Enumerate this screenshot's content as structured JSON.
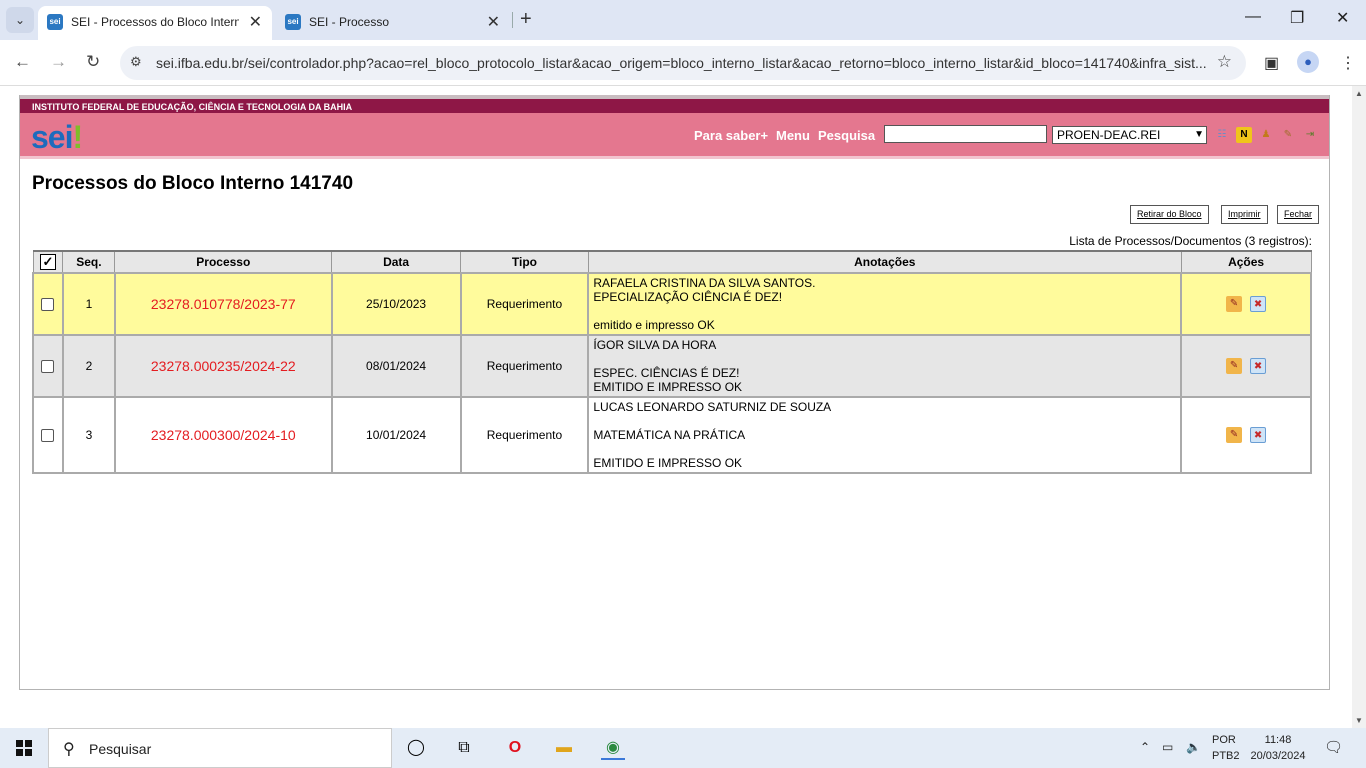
{
  "browser": {
    "tabs": [
      {
        "title": "SEI - Processos do Bloco Interno"
      },
      {
        "title": "SEI - Processo"
      }
    ],
    "new_tab": "+",
    "url": "sei.ifba.edu.br/sei/controlador.php?acao=rel_bloco_protocolo_listar&acao_origem=bloco_interno_listar&acao_retorno=bloco_interno_listar&id_bloco=141740&infra_sist..."
  },
  "sei": {
    "institution": "INSTITUTO FEDERAL DE EDUCAÇÃO, CIÊNCIA E TECNOLOGIA DA BAHIA",
    "logo": "sei",
    "nav": {
      "help": "Para saber+",
      "menu": "Menu",
      "search": "Pesquisa"
    },
    "search_value": "",
    "unit_select": "PROEN-DEAC.REI",
    "page_title": "Processos do Bloco Interno 141740",
    "buttons": {
      "remove": "Retirar do Bloco",
      "print": "Imprimir",
      "close": "Fechar"
    },
    "count_text": "Lista de Processos/Documentos (3 registros):",
    "table": {
      "headers": {
        "seq": "Seq.",
        "processo": "Processo",
        "data": "Data",
        "tipo": "Tipo",
        "anotacoes": "Anotações",
        "acoes": "Ações"
      },
      "rows": [
        {
          "seq": "1",
          "processo": "23278.010778/2023-77",
          "data": "25/10/2023",
          "tipo": "Requerimento",
          "anotacoes": "RAFAELA CRISTINA DA SILVA SANTOS.\nEPECIALIZAÇÃO CIÊNCIA É DEZ!\n\nemitido e impresso OK"
        },
        {
          "seq": "2",
          "processo": "23278.000235/2024-22",
          "data": "08/01/2024",
          "tipo": "Requerimento",
          "anotacoes": "ÍGOR SILVA DA HORA\n\nESPEC. CIÊNCIAS É DEZ!\nEMITIDO E IMPRESSO OK"
        },
        {
          "seq": "3",
          "processo": "23278.000300/2024-10",
          "data": "10/01/2024",
          "tipo": "Requerimento",
          "anotacoes": "LUCAS LEONARDO SATURNIZ DE SOUZA\n\nMATEMÁTICA NA PRÁTICA\n\nEMITIDO E IMPRESSO OK"
        }
      ]
    }
  },
  "taskbar": {
    "search_placeholder": "Pesquisar",
    "lang_top": "POR",
    "lang_bottom": "PTB2",
    "time": "11:48",
    "date": "20/03/2024"
  }
}
